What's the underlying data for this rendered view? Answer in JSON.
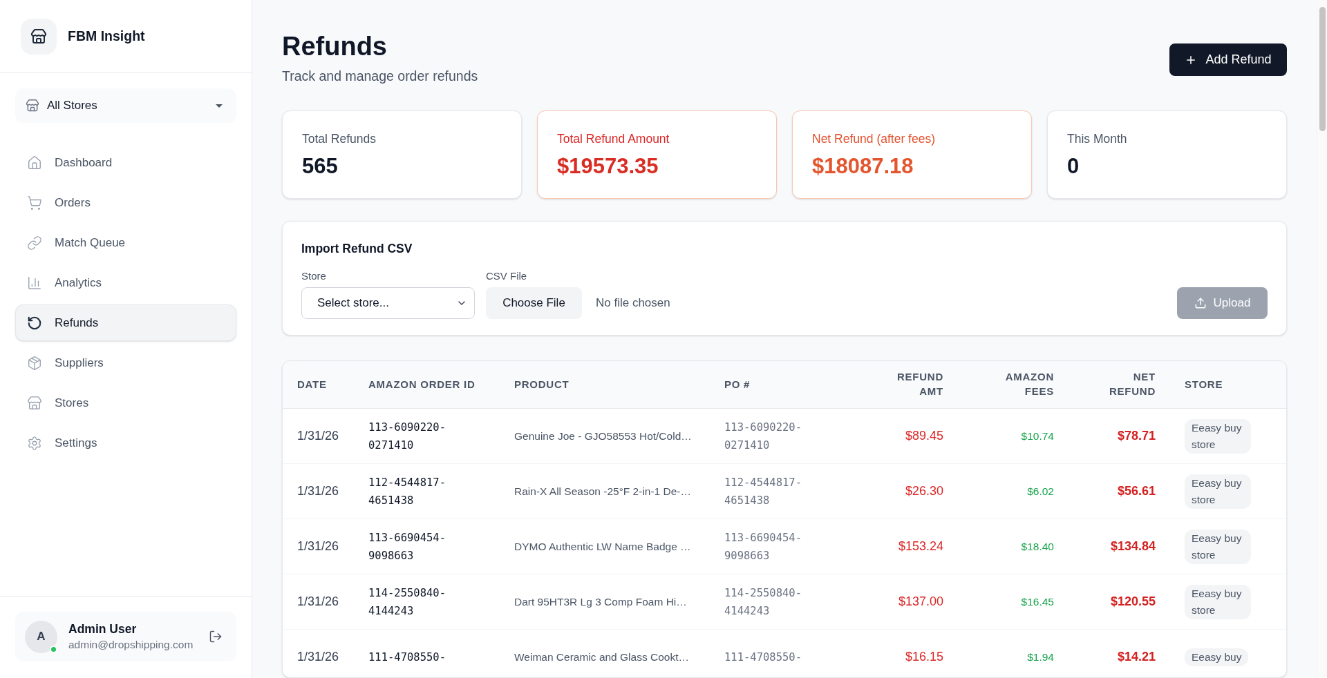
{
  "sidebar": {
    "brand": "FBM Insight",
    "store_selector": {
      "value": "All Stores"
    },
    "nav_items": [
      {
        "label": "Dashboard",
        "selected": false
      },
      {
        "label": "Orders",
        "selected": false
      },
      {
        "label": "Match Queue",
        "selected": false
      },
      {
        "label": "Analytics",
        "selected": false
      },
      {
        "label": "Refunds",
        "selected": true
      },
      {
        "label": "Suppliers",
        "selected": false
      },
      {
        "label": "Stores",
        "selected": false
      },
      {
        "label": "Settings",
        "selected": false
      }
    ],
    "user": {
      "initial": "A",
      "name": "Admin User",
      "email": "admin@dropshipping.com",
      "online": true
    }
  },
  "page": {
    "title": "Refunds",
    "subtitle": "Track and manage order refunds",
    "primary_button": {
      "label": "Add Refund"
    }
  },
  "stats": [
    {
      "label": "Total Refunds",
      "value": "565",
      "kind": "plain"
    },
    {
      "label": "Total Refund Amount",
      "value": "$19573.35",
      "kind": "danger"
    },
    {
      "label": "Net Refund (after fees)",
      "value": "$18087.18",
      "kind": "warning"
    },
    {
      "label": "This Month",
      "value": "0",
      "kind": "plain"
    }
  ],
  "import_panel": {
    "title": "Import Refund CSV",
    "store_field": {
      "label": "Store",
      "placeholder": "Select store..."
    },
    "file_field": {
      "label": "CSV File",
      "button": "Choose File",
      "status": "No file chosen"
    },
    "upload_button": {
      "label": "Upload",
      "disabled": true
    }
  },
  "table": {
    "columns": [
      "DATE",
      "AMAZON ORDER ID",
      "PRODUCT",
      "PO #",
      "REFUND AMT",
      "AMAZON FEES",
      "NET REFUND",
      "STORE"
    ],
    "rows": [
      {
        "date": "1/31/26",
        "order_id": "113-6090220-0271410",
        "product": "Genuine Joe - GJO58553 Hot/Cold…",
        "po": "113-6090220-0271410",
        "refund_amt": "$89.45",
        "amazon_fees": "$10.74",
        "net_refund": "$78.71",
        "store": "Eeasy buy store"
      },
      {
        "date": "1/31/26",
        "order_id": "112-4544817-4651438",
        "product": "Rain-X All Season -25°F 2-in-1 De-…",
        "po": "112-4544817-4651438",
        "refund_amt": "$26.30",
        "amazon_fees": "$6.02",
        "net_refund": "$56.61",
        "store": "Eeasy buy store"
      },
      {
        "date": "1/31/26",
        "order_id": "113-6690454-9098663",
        "product": "DYMO Authentic LW Name Badge …",
        "po": "113-6690454-9098663",
        "refund_amt": "$153.24",
        "amazon_fees": "$18.40",
        "net_refund": "$134.84",
        "store": "Eeasy buy store"
      },
      {
        "date": "1/31/26",
        "order_id": "114-2550840-4144243",
        "product": "Dart 95HT3R Lg 3 Comp Foam Hi…",
        "po": "114-2550840-4144243",
        "refund_amt": "$137.00",
        "amazon_fees": "$16.45",
        "net_refund": "$120.55",
        "store": "Eeasy buy store"
      },
      {
        "date": "1/31/26",
        "order_id": "111-4708550-",
        "product": "Weiman Ceramic and Glass Cookt…",
        "po": "111-4708550-",
        "refund_amt": "$16.15",
        "amazon_fees": "$1.94",
        "net_refund": "$14.21",
        "store": "Eeasy buy"
      }
    ]
  }
}
